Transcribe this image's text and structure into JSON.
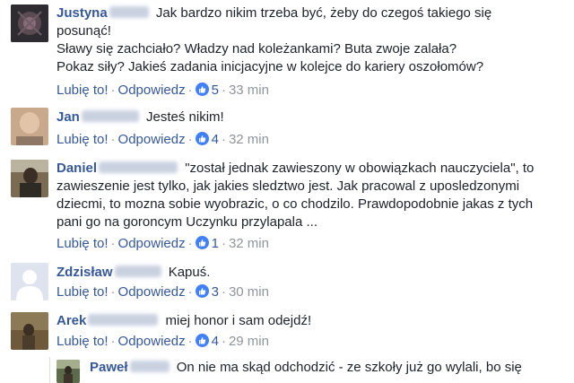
{
  "comments": [
    {
      "author_first": "Justyna",
      "lines": [
        "Jak bardzo nikim trzeba być, żeby do czegoś takiego się",
        "posunąć!",
        "Sławy się zachciało? Władzy nad koleżankami? Buta zwoje zalała?",
        "Pokaz siły? Jakieś zadania inicjacyjne w kolejce do kariery oszołomów?"
      ],
      "like_label": "Lubię to!",
      "reply_label": "Odpowiedz",
      "like_count": "5",
      "time": "33 min"
    },
    {
      "author_first": "Jan",
      "lines": [
        "Jesteś nikim!"
      ],
      "like_label": "Lubię to!",
      "reply_label": "Odpowiedz",
      "like_count": "4",
      "time": "32 min"
    },
    {
      "author_first": "Daniel",
      "lines": [
        "\"został jednak zawieszony w obowiązkach nauczyciela\", to",
        "zawieszenie jest tylko, jak jakies sledztwo jest. Jak pracowal z uposledzonymi",
        "dziecmi, to mozna sobie wyobrazic, o co chodzilo. Prawdopodobnie jakas z tych",
        "pani go na goroncym Uczynku przylapala ..."
      ],
      "like_label": "Lubię to!",
      "reply_label": "Odpowiedz",
      "like_count": "1",
      "time": "32 min"
    },
    {
      "author_first": "Zdzisław",
      "lines": [
        "Kapuś."
      ],
      "like_label": "Lubię to!",
      "reply_label": "Odpowiedz",
      "like_count": "3",
      "time": "30 min"
    },
    {
      "author_first": "Arek",
      "lines": [
        "miej honor i sam odejdź!"
      ],
      "like_label": "Lubię to!",
      "reply_label": "Odpowiedz",
      "like_count": "4",
      "time": "29 min"
    }
  ],
  "reply": {
    "author_first": "Paweł",
    "line": "On nie ma skąd odchodzić - ze szkoły już go wylali, bo się"
  },
  "colors": {
    "link": "#365899",
    "meta": "#90949c",
    "like_badge": "#4080ff"
  }
}
